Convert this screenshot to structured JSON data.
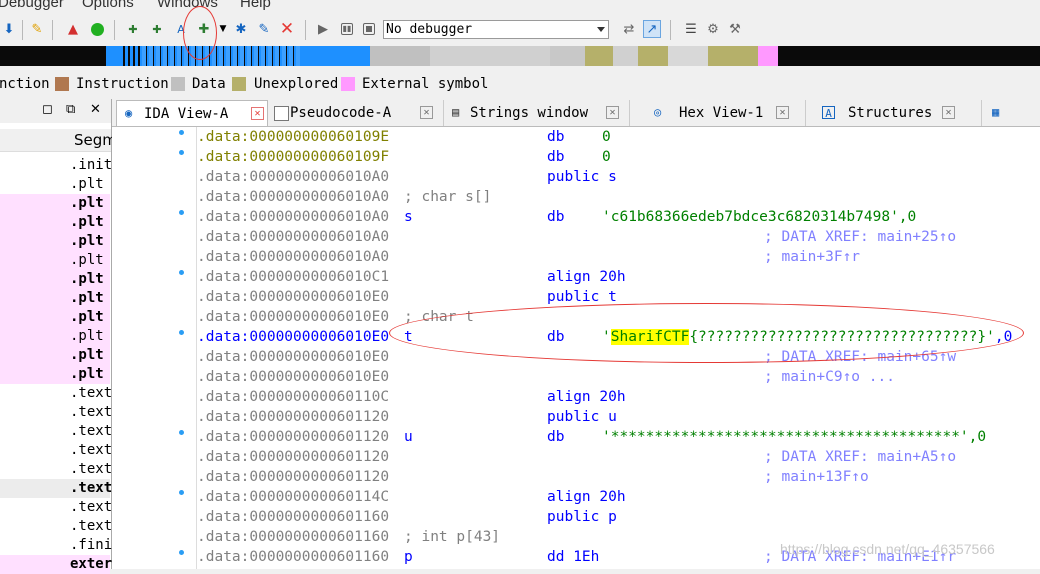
{
  "menu": [
    "Debugger",
    "Options",
    "Windows",
    "Help"
  ],
  "toolbar": {
    "debugger_select": "No debugger",
    "icons": [
      "arrow-down-icon",
      "script-icon",
      "warning-icon",
      "green-dot-icon",
      "create-code-icon",
      "create-data-icon",
      "create-text-icon",
      "add-icon",
      "dropdown-icon",
      "star-icon",
      "edit-icon",
      "delete-icon",
      "play-icon",
      "pause-icon",
      "stop-icon",
      "breakpoint-icon",
      "pointer-icon",
      "list-icon",
      "plugin-icon",
      "tools-icon"
    ]
  },
  "legend": [
    {
      "label": "nction",
      "color": "#ffffff"
    },
    {
      "label": "Instruction",
      "color": "#b07850"
    },
    {
      "label": "Data",
      "color": "#c0c0c0"
    },
    {
      "label": "Unexplored",
      "color": "#b5b06a"
    },
    {
      "label": "External symbol",
      "color": "#ff99ff"
    }
  ],
  "left_panel": {
    "column_header": "Segm",
    "rows": [
      {
        "name": ".init",
        "bold": false,
        "pink": false
      },
      {
        "name": ".plt",
        "bold": false,
        "pink": false
      },
      {
        "name": ".plt",
        "bold": true,
        "pink": true
      },
      {
        "name": ".plt",
        "bold": true,
        "pink": true
      },
      {
        "name": ".plt",
        "bold": true,
        "pink": true
      },
      {
        "name": ".plt",
        "bold": false,
        "pink": true
      },
      {
        "name": ".plt",
        "bold": true,
        "pink": true
      },
      {
        "name": ".plt",
        "bold": true,
        "pink": true
      },
      {
        "name": ".plt",
        "bold": true,
        "pink": true
      },
      {
        "name": ".plt",
        "bold": false,
        "pink": true
      },
      {
        "name": ".plt",
        "bold": true,
        "pink": true
      },
      {
        "name": ".plt",
        "bold": true,
        "pink": true
      },
      {
        "name": ".text",
        "bold": false,
        "pink": false
      },
      {
        "name": ".text",
        "bold": false,
        "pink": false
      },
      {
        "name": ".text",
        "bold": false,
        "pink": false
      },
      {
        "name": ".text",
        "bold": false,
        "pink": false
      },
      {
        "name": ".text",
        "bold": false,
        "pink": false
      },
      {
        "name": ".text",
        "bold": true,
        "pink": false
      },
      {
        "name": ".text",
        "bold": false,
        "pink": false
      },
      {
        "name": ".text",
        "bold": false,
        "pink": false
      },
      {
        "name": ".fini",
        "bold": false,
        "pink": false
      },
      {
        "name": "exter",
        "bold": true,
        "pink": true
      }
    ]
  },
  "tabs": [
    {
      "label": "IDA View-A",
      "active": true
    },
    {
      "label": "Pseudocode-A",
      "active": false
    },
    {
      "label": "Strings window",
      "active": false
    },
    {
      "label": "Hex View-1",
      "active": false
    },
    {
      "label": "Structures",
      "active": false
    },
    {
      "label": "",
      "active": false
    }
  ],
  "lines": [
    {
      "addr": ".data:000000000060109E",
      "addr_color": "olive",
      "label": "",
      "comment": "",
      "mnem": "db",
      "operand": "0",
      "xref": "",
      "dot": true
    },
    {
      "addr": ".data:000000000060109F",
      "addr_color": "olive",
      "label": "",
      "comment": "",
      "mnem": "db",
      "operand": "0",
      "xref": "",
      "dot": true
    },
    {
      "addr": ".data:00000000006010A0",
      "addr_color": "gray",
      "label": "",
      "comment": "",
      "mnem": "public s",
      "operand": "",
      "xref": "",
      "dot": false
    },
    {
      "addr": ".data:00000000006010A0",
      "addr_color": "gray",
      "label": "",
      "comment": "; char s[]",
      "mnem": "",
      "operand": "",
      "xref": "",
      "dot": false
    },
    {
      "addr": ".data:00000000006010A0",
      "addr_color": "gray",
      "label": "s",
      "comment": "",
      "mnem": "db",
      "operand": "'c61b68366edeb7bdce3c6820314b7498',0",
      "xref": "",
      "dot": true
    },
    {
      "addr": ".data:00000000006010A0",
      "addr_color": "gray",
      "label": "",
      "comment": "",
      "mnem": "",
      "operand": "",
      "xref": "; DATA XREF: main+25↑o",
      "dot": false
    },
    {
      "addr": ".data:00000000006010A0",
      "addr_color": "gray",
      "label": "",
      "comment": "",
      "mnem": "",
      "operand": "",
      "xref": "; main+3F↑r",
      "dot": false
    },
    {
      "addr": ".data:00000000006010C1",
      "addr_color": "gray",
      "label": "",
      "comment": "",
      "mnem": "align 20h",
      "operand": "",
      "xref": "",
      "dot": true
    },
    {
      "addr": ".data:00000000006010E0",
      "addr_color": "gray",
      "label": "",
      "comment": "",
      "mnem": "public t",
      "operand": "",
      "xref": "",
      "dot": false
    },
    {
      "addr": ".data:00000000006010E0",
      "addr_color": "gray",
      "label": "",
      "comment": "; char t",
      "mnem": "",
      "operand": "",
      "xref": "",
      "dot": false
    },
    {
      "addr": ".data:00000000006010E0",
      "addr_color": "blue",
      "label": "t",
      "comment": "",
      "mnem": "db",
      "operand": "",
      "xref": "",
      "dot": true,
      "flag": true
    },
    {
      "addr": ".data:00000000006010E0",
      "addr_color": "gray",
      "label": "",
      "comment": "",
      "mnem": "",
      "operand": "",
      "xref": "; DATA XREF: main+65↑w",
      "dot": false
    },
    {
      "addr": ".data:00000000006010E0",
      "addr_color": "gray",
      "label": "",
      "comment": "",
      "mnem": "",
      "operand": "",
      "xref": "; main+C9↑o ...",
      "dot": false
    },
    {
      "addr": ".data:000000000060110C",
      "addr_color": "gray",
      "label": "",
      "comment": "",
      "mnem": "align 20h",
      "operand": "",
      "xref": "",
      "dot": false
    },
    {
      "addr": ".data:0000000000601120",
      "addr_color": "gray",
      "label": "",
      "comment": "",
      "mnem": "public u",
      "operand": "",
      "xref": "",
      "dot": false
    },
    {
      "addr": ".data:0000000000601120",
      "addr_color": "gray",
      "label": "u",
      "comment": "",
      "mnem": "db",
      "operand": "'****************************************',0",
      "xref": "",
      "dot": true
    },
    {
      "addr": ".data:0000000000601120",
      "addr_color": "gray",
      "label": "",
      "comment": "",
      "mnem": "",
      "operand": "",
      "xref": "; DATA XREF: main+A5↑o",
      "dot": false
    },
    {
      "addr": ".data:0000000000601120",
      "addr_color": "gray",
      "label": "",
      "comment": "",
      "mnem": "",
      "operand": "",
      "xref": "; main+13F↑o",
      "dot": false
    },
    {
      "addr": ".data:000000000060114C",
      "addr_color": "gray",
      "label": "",
      "comment": "",
      "mnem": "align 20h",
      "operand": "",
      "xref": "",
      "dot": true
    },
    {
      "addr": ".data:0000000000601160",
      "addr_color": "gray",
      "label": "",
      "comment": "",
      "mnem": "public p",
      "operand": "",
      "xref": "",
      "dot": false
    },
    {
      "addr": ".data:0000000000601160",
      "addr_color": "gray",
      "label": "",
      "comment": "; int p[43]",
      "mnem": "",
      "operand": "",
      "xref": "",
      "dot": false
    },
    {
      "addr": ".data:0000000000601160",
      "addr_color": "gray",
      "label": "p",
      "comment": "",
      "mnem": "dd 1Eh",
      "operand": "",
      "xref": "; DATA XREF: main+E1↑r",
      "dot": true
    }
  ],
  "flag_line": {
    "prefix": "'",
    "highlight": "SharifCTF",
    "rest": "{????????????????????????????????}'",
    "suffix": ",0"
  },
  "watermark": "https://blog.csdn.net/qq_46357566"
}
